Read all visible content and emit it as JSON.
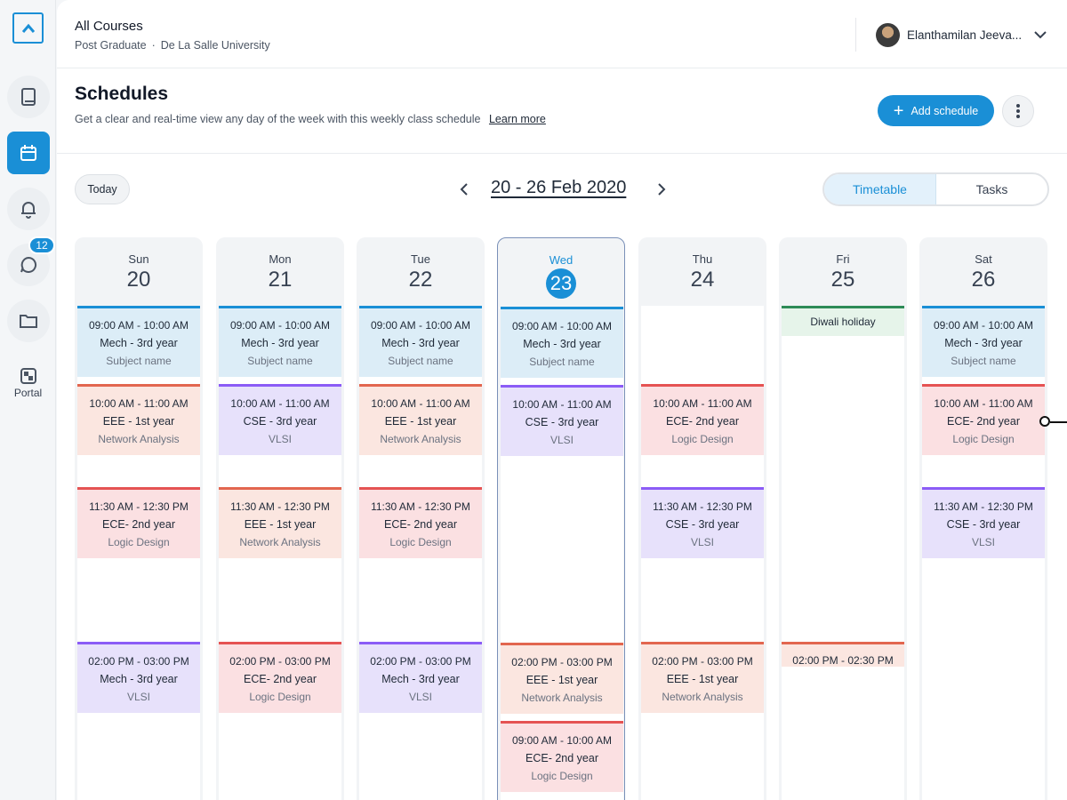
{
  "header": {
    "title": "All Courses",
    "program": "Post Graduate",
    "university": "De La Salle University",
    "user_name": "Elanthamilan Jeeva..."
  },
  "sidebar": {
    "messages_badge": "12",
    "portal_label": "Portal"
  },
  "page": {
    "title": "Schedules",
    "description": "Get a clear and real-time view any day of the week with this weekly class schedule",
    "learn_more": "Learn more",
    "add_label": "Add schedule"
  },
  "controls": {
    "today_label": "Today",
    "date_range": "20 - 26 Feb 2020",
    "view_tabs": [
      "Timetable",
      "Tasks"
    ],
    "active_view": "Timetable"
  },
  "days": [
    {
      "name": "Sun",
      "num": "20",
      "current": false,
      "events": [
        {
          "time": "09:00 AM - 10:00 AM",
          "course": "Mech - 3rd year",
          "subject": "Subject name",
          "color": "blue"
        },
        {
          "time": "10:00 AM - 11:00 AM",
          "course": "EEE - 1st year",
          "subject": "Network Analysis",
          "color": "salmon"
        },
        {
          "time": "11:30 AM - 12:30 PM",
          "course": "ECE- 2nd year",
          "subject": "Logic Design",
          "color": "pink"
        },
        {
          "time": "02:00 PM - 03:00 PM",
          "course": "Mech - 3rd year",
          "subject": "VLSI",
          "color": "purple"
        }
      ]
    },
    {
      "name": "Mon",
      "num": "21",
      "current": false,
      "events": [
        {
          "time": "09:00 AM - 10:00 AM",
          "course": "Mech - 3rd year",
          "subject": "Subject name",
          "color": "blue"
        },
        {
          "time": "10:00 AM - 11:00 AM",
          "course": "CSE - 3rd year",
          "subject": "VLSI",
          "color": "purple"
        },
        {
          "time": "11:30 AM - 12:30 PM",
          "course": "EEE - 1st year",
          "subject": "Network Analysis",
          "color": "salmon"
        },
        {
          "time": "02:00 PM - 03:00 PM",
          "course": "ECE- 2nd year",
          "subject": "Logic Design",
          "color": "pink"
        }
      ]
    },
    {
      "name": "Tue",
      "num": "22",
      "current": false,
      "events": [
        {
          "time": "09:00 AM - 10:00 AM",
          "course": "Mech - 3rd year",
          "subject": "Subject name",
          "color": "blue"
        },
        {
          "time": "10:00 AM - 11:00 AM",
          "course": "EEE - 1st year",
          "subject": "Network Analysis",
          "color": "salmon"
        },
        {
          "time": "11:30 AM - 12:30 PM",
          "course": "ECE- 2nd year",
          "subject": "Logic Design",
          "color": "pink"
        },
        {
          "time": "02:00 PM - 03:00 PM",
          "course": "Mech - 3rd year",
          "subject": "VLSI",
          "color": "purple"
        }
      ]
    },
    {
      "name": "Wed",
      "num": "23",
      "current": true,
      "events": [
        {
          "time": "09:00 AM - 10:00 AM",
          "course": "Mech - 3rd year",
          "subject": "Subject name",
          "color": "blue"
        },
        {
          "time": "10:00 AM - 11:00 AM",
          "course": "CSE - 3rd year",
          "subject": "VLSI",
          "color": "purple"
        },
        {
          "time": "02:00 PM - 03:00 PM",
          "course": "EEE - 1st year",
          "subject": "Network Analysis",
          "color": "salmon"
        },
        {
          "time": "09:00 AM - 10:00 AM",
          "course": "ECE- 2nd year",
          "subject": "Logic Design",
          "color": "pink"
        }
      ]
    },
    {
      "name": "Thu",
      "num": "24",
      "current": false,
      "events": [
        {
          "time": "10:00 AM - 11:00 AM",
          "course": "ECE- 2nd year",
          "subject": "Logic Design",
          "color": "pink"
        },
        {
          "time": "11:30 AM - 12:30 PM",
          "course": "CSE - 3rd year",
          "subject": "VLSI",
          "color": "purple"
        },
        {
          "time": "02:00 PM - 03:00 PM",
          "course": "EEE - 1st year",
          "subject": "Network Analysis",
          "color": "salmon"
        }
      ]
    },
    {
      "name": "Fri",
      "num": "25",
      "current": false,
      "events": [
        {
          "title": "Diwali holiday",
          "color": "green"
        },
        {
          "time": "02:00 PM - 02:30 PM",
          "color": "salmon"
        }
      ]
    },
    {
      "name": "Sat",
      "num": "26",
      "current": false,
      "events": [
        {
          "time": "09:00 AM - 10:00 AM",
          "course": "Mech - 3rd year",
          "subject": "Subject name",
          "color": "blue"
        },
        {
          "time": "10:00 AM - 11:00 AM",
          "course": "ECE- 2nd year",
          "subject": "Logic Design",
          "color": "pink"
        },
        {
          "time": "11:30 AM - 12:30 PM",
          "course": "CSE - 3rd year",
          "subject": "VLSI",
          "color": "purple"
        }
      ]
    }
  ],
  "colors": {
    "accent": "#1a8fd6",
    "blue": "#dcedf7",
    "purple": "#e7e1fb",
    "salmon": "#fbe6e0",
    "pink": "#fbe0e2",
    "green": "#e6f4ea"
  }
}
